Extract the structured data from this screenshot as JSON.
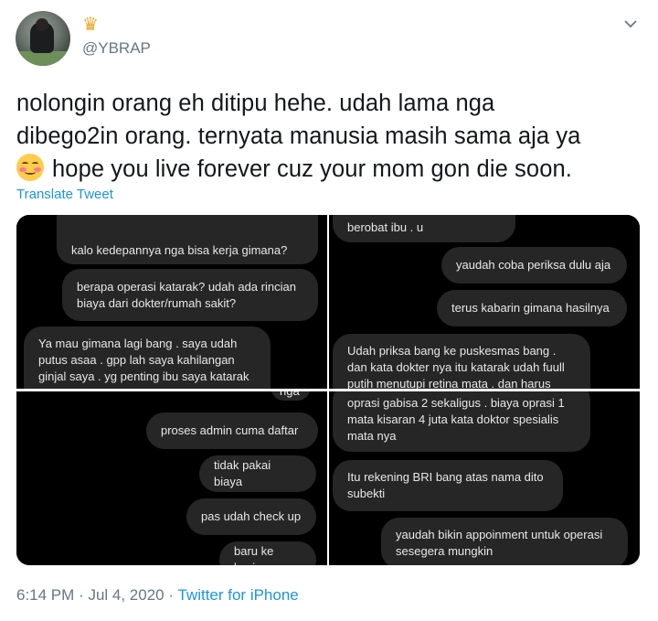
{
  "author": {
    "avatar_icon": "profile-photo-avatar",
    "badge_icon": "crown-icon",
    "handle": "@YBRAP"
  },
  "tweet": {
    "lines": [
      "nolongin orang eh ditipu hehe. udah lama nga",
      "dibego2in orang. ternyata manusia masih sama aja ya",
      "hope you live forever cuz your mom gon die soon."
    ],
    "emoji_icon": "smiling-face-with-blush-icon",
    "translate_label": "Translate Tweet"
  },
  "media": {
    "top_left": [
      "kalo kedepannya nga bisa kerja gimana?",
      "berapa operasi katarak? udah ada rincian",
      "biaya dari dokter/rumah sakit?",
      "Ya mau gimana lagi bang . saya udah",
      "putus asaa . gpp lah saya kahilangan",
      "ginjal saya . yg penting ibu saya katarak"
    ],
    "top_right": [
      "berobat ibu . u",
      "yaudah coba periksa dulu aja",
      "terus kabarin gimana hasilnya",
      "Udah priksa bang ke puskesmas bang .",
      "dan kata dokter nya itu katarak udah fuull",
      "putih menutupi retina mata . dan harus"
    ],
    "bottom_left": [
      "nga",
      "proses admin cuma daftar",
      "tidak pakai biaya",
      "pas udah check up",
      "baru ke kasir"
    ],
    "bottom_right": [
      "oprasi gabisa 2 sekaligus . biaya oprasi 1",
      "mata kisaran 4 juta kata doktor spesialis",
      "mata nya",
      "Itu rekening BRI bang atas nama dito",
      "subekti",
      "yaudah bikin appoinment untuk operasi",
      "sesegera mungkin"
    ]
  },
  "footer": {
    "time": "6:14 PM",
    "separator": "·",
    "date": "Jul 4, 2020",
    "separator2": "·",
    "source": "Twitter for iPhone"
  },
  "colors": {
    "link": "#1b95e0",
    "secondary_text": "#657786",
    "bubble": "#262626"
  }
}
